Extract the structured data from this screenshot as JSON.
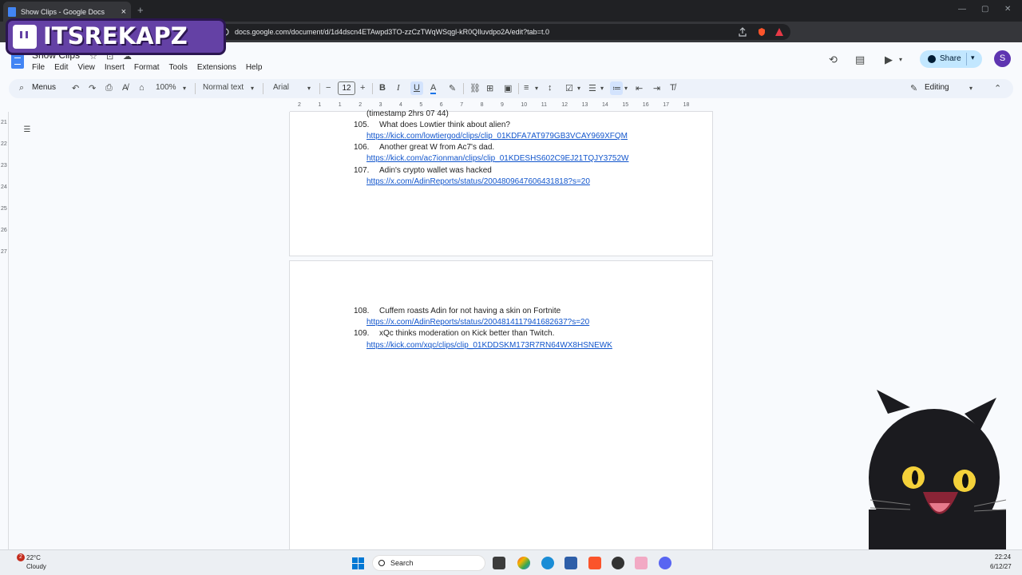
{
  "browser": {
    "tab_title": "Show Clips - Google Docs",
    "tab_close": "×",
    "new_tab": "+",
    "url": "docs.google.com/document/d/1d4dscn4ETAwpd3TO-zzCzTWqWSqgl-kR0QIluvdpo2A/edit?tab=t.0"
  },
  "overlay": {
    "name": "ITSREKAPZ",
    "icon": "twitch-icon"
  },
  "docs": {
    "title": "Show Clips",
    "menu": [
      "File",
      "Edit",
      "View",
      "Insert",
      "Format",
      "Tools",
      "Extensions",
      "Help"
    ],
    "share_label": "Share",
    "avatar_letter": "S"
  },
  "toolbar": {
    "menus_label": "Menus",
    "zoom": "100%",
    "style": "Normal text",
    "font": "Arial",
    "font_size": "12",
    "editing_label": "Editing"
  },
  "ruler": {
    "h_ticks": [
      "2",
      "1",
      "1",
      "2",
      "3",
      "4",
      "5",
      "6",
      "7",
      "8",
      "9",
      "10",
      "11",
      "12",
      "13",
      "14",
      "15",
      "16",
      "17",
      "18"
    ],
    "v_ticks": [
      "21",
      "22",
      "23",
      "24",
      "25",
      "26",
      "27"
    ]
  },
  "document": {
    "page1": {
      "partial_line": "(timestamp 2hrs 07 44)",
      "items": [
        {
          "num": "105.",
          "text": "What does Lowtier think about alien?",
          "link": "https://kick.com/lowtiergod/clips/clip_01KDFA7AT979GB3VCAY969XFQM"
        },
        {
          "num": "106.",
          "text": "Another great W from Ac7's dad.",
          "link": "https://kick.com/ac7ionman/clips/clip_01KDESHS602C9EJ21TQJY3752W"
        },
        {
          "num": "107.",
          "text": "Adin's crypto wallet was hacked",
          "link": "https://x.com/AdinReports/status/2004809647606431818?s=20"
        }
      ]
    },
    "page2": {
      "items": [
        {
          "num": "108.",
          "text": "Cuffem roasts Adin for not having a skin on Fortnite",
          "link": "https://x.com/AdinReports/status/2004814117941682637?s=20"
        },
        {
          "num": "109.",
          "text": "xQc thinks moderation on Kick better than Twitch.",
          "link": "https://kick.com/xqc/clips/clip_01KDDSKM173R7RN64WX8HSNEWK"
        }
      ]
    }
  },
  "taskbar": {
    "weather_badge": "2",
    "temperature": "22°C",
    "condition": "Cloudy",
    "search_label": "Search",
    "time": "22:24",
    "date": "6/12/27"
  }
}
